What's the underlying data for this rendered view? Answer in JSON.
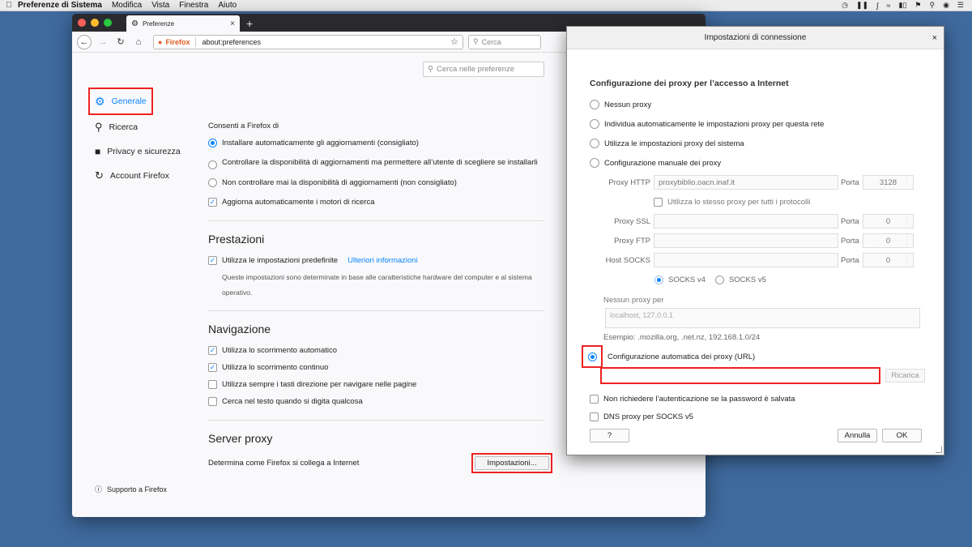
{
  "menubar": {
    "app": "Preferenze di Sistema",
    "items": [
      "Modifica",
      "Vista",
      "Finestra",
      "Aiuto"
    ]
  },
  "browser": {
    "tab_title": "Preferenze",
    "url_label": "Firefox",
    "url": "about:preferences",
    "search_placeholder": "Cerca",
    "pref_search_placeholder": "Cerca nelle preferenze"
  },
  "sidebar": {
    "items": [
      {
        "label": "Generale",
        "icon": "gear-icon"
      },
      {
        "label": "Ricerca",
        "icon": "search-icon"
      },
      {
        "label": "Privacy e sicurezza",
        "icon": "lock-icon"
      },
      {
        "label": "Account Firefox",
        "icon": "sync-icon"
      }
    ],
    "support": "Supporto a Firefox"
  },
  "updates": {
    "heading": "Consenti a Firefox di",
    "opt1": "Installare automaticamente gli aggiornamenti (consigliato)",
    "opt2": "Controllare la disponibilità di aggiornamenti ma permettere all’utente di scegliere se installarli",
    "opt3": "Non controllare mai la disponibilità di aggiornamenti (non consigliato)",
    "auto_search": "Aggiorna automaticamente i motori di ricerca"
  },
  "performance": {
    "heading": "Prestazioni",
    "use_defaults": "Utilizza le impostazioni predefinite",
    "more_info": "Ulteriori informazioni",
    "note": "Queste impostazioni sono determinate in base alle caratteristiche hardware del computer e al sistema operativo."
  },
  "navigation": {
    "heading": "Navigazione",
    "autoscroll": "Utilizza lo scorrimento automatico",
    "smooth": "Utilizza lo scorrimento continuo",
    "cursor_keys": "Utilizza sempre i tasti direzione per navigare nelle pagine",
    "find_typing": "Cerca nel testo quando si digita qualcosa"
  },
  "proxy": {
    "heading": "Server proxy",
    "description": "Determina come Firefox si collega a Internet",
    "settings_button": "Impostazioni..."
  },
  "dialog": {
    "title": "Impostazioni di connessione",
    "section": "Configurazione dei proxy per l’accesso a Internet",
    "no_proxy": "Nessun proxy",
    "auto_detect": "Individua automaticamente le impostazioni proxy per questa rete",
    "system": "Utilizza le impostazioni proxy del sistema",
    "manual": "Configurazione manuale dei proxy",
    "http_label": "Proxy HTTP",
    "http_value": "proxybiblio.oacn.inaf.it",
    "port_label": "Porta",
    "http_port": "3128",
    "same_proxy": "Utilizza lo stesso proxy per tutti i protocolli",
    "ssl_label": "Proxy SSL",
    "ssl_port": "0",
    "ftp_label": "Proxy FTP",
    "ftp_port": "0",
    "socks_label": "Host SOCKS",
    "socks_port": "0",
    "socks_v4": "SOCKS v4",
    "socks_v5": "SOCKS v5",
    "no_proxy_for": "Nessun proxy per",
    "no_proxy_value": "localhost, 127.0.0.1",
    "example": "Esempio: .mozilla.org, .net.nz, 192.168.1.0/24",
    "auto_url": "Configurazione automatica dei proxy (URL)",
    "reload": "Ricarica",
    "no_auth": "Non richiedere l’autenticazione se la password è salvata",
    "dns_socks": "DNS proxy per SOCKS v5",
    "help": "?",
    "cancel": "Annulla",
    "ok": "OK"
  }
}
